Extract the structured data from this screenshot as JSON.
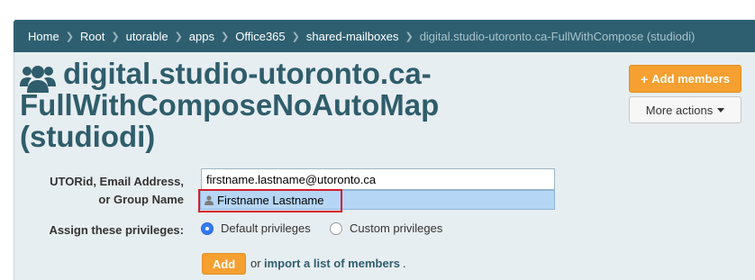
{
  "breadcrumb": {
    "items": [
      "Home",
      "Root",
      "utorable",
      "apps",
      "Office365",
      "shared-mailboxes",
      "digital.studio-utoronto.ca-FullWithCompose (studiodi)"
    ]
  },
  "page": {
    "title": "digital.studio-utoronto.ca-FullWithComposeNoAutoMap (studiodi)",
    "title_icon": "users-icon"
  },
  "actions": {
    "add_members_label": "Add members",
    "more_actions_label": "More actions"
  },
  "form": {
    "id_label_line1": "UTORid, Email Address,",
    "id_label_line2": "or Group Name",
    "id_value": "firstname.lastname@utoronto.ca",
    "suggestion": "Firstname Lastname",
    "privileges_label": "Assign these privileges:",
    "privilege_options": [
      {
        "label": "Default privileges",
        "selected": true
      },
      {
        "label": "Custom privileges",
        "selected": false
      }
    ],
    "add_label": "Add",
    "or_text": "or",
    "import_link": "import a list of members",
    "trailing": "."
  },
  "colors": {
    "breadcrumb_bg": "#2e5f70",
    "title": "#2f5d6c",
    "accent_orange": "#f5a030",
    "panel_bg": "#e7eef1",
    "highlight": "#d3202a"
  }
}
